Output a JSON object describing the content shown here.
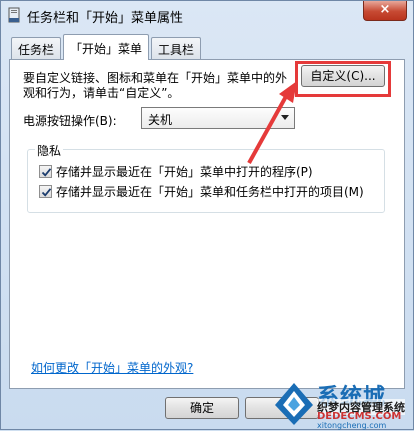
{
  "window": {
    "title": "任务栏和「开始」菜单属性",
    "close_label": "×"
  },
  "tabs": [
    {
      "label": "任务栏",
      "active": false
    },
    {
      "label": "「开始」菜单",
      "active": true
    },
    {
      "label": "工具栏",
      "active": false
    }
  ],
  "start_menu": {
    "description": "要自定义链接、图标和菜单在「开始」菜单中的外观和行为，请单击“自定义”。",
    "customize_label": "自定义(C)...",
    "power_label": "电源按钮操作(B):",
    "power_value": "关机"
  },
  "privacy": {
    "label": "隐私",
    "option_programs": "存储并显示最近在「开始」菜单中打开的程序(P)",
    "option_items": "存储并显示最近在「开始」菜单和任务栏中打开的项目(M)",
    "programs_checked": true,
    "items_checked": true
  },
  "link_text": "如何更改「开始」菜单的外观?",
  "footer": {
    "ok_label": "确定",
    "cancel_label": "消"
  },
  "annotation": {
    "color": "#e53a3a"
  },
  "watermark": {
    "brand": "系统城",
    "cms": "织梦内容管理系统",
    "url": "DEDECMS.COM",
    "site": "xitongcheng.com"
  },
  "colors": {
    "link": "#0066cc",
    "close_button": "#c74a33",
    "watermark_blue": "#1a6db5"
  }
}
